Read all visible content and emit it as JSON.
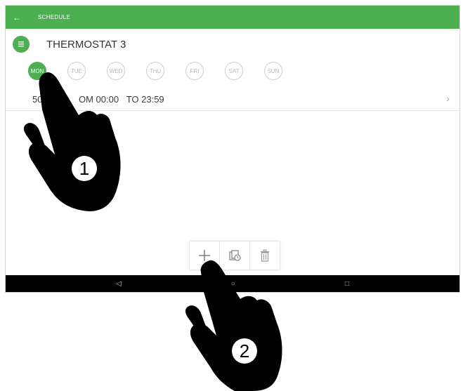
{
  "appbar": {
    "back_icon": "arrow-left-icon",
    "title": "SCHEDULE"
  },
  "device": {
    "icon": "thermostat-icon",
    "name": "THERMOSTAT 3"
  },
  "days": [
    {
      "label": "MON",
      "selected": true
    },
    {
      "label": "TUE",
      "selected": false
    },
    {
      "label": "WED",
      "selected": false
    },
    {
      "label": "THU",
      "selected": false
    },
    {
      "label": "FRI",
      "selected": false
    },
    {
      "label": "SAT",
      "selected": false
    },
    {
      "label": "SUN",
      "selected": false
    }
  ],
  "schedule": {
    "temp_visible": "50",
    "from_visible": "OM 00:00",
    "to_label": "TO 23:59",
    "chevron_icon": "chevron-right-icon"
  },
  "toolbar": {
    "add_icon": "plus-icon",
    "copy_icon": "copy-schedule-icon",
    "delete_icon": "trash-icon"
  },
  "navbar": {
    "back_icon": "nav-back-icon",
    "home_icon": "nav-home-icon",
    "recent_icon": "nav-recent-icon"
  },
  "annotations": {
    "step1": "1",
    "step2": "2"
  },
  "colors": {
    "accent": "#4caf50",
    "navbar": "#000000"
  }
}
